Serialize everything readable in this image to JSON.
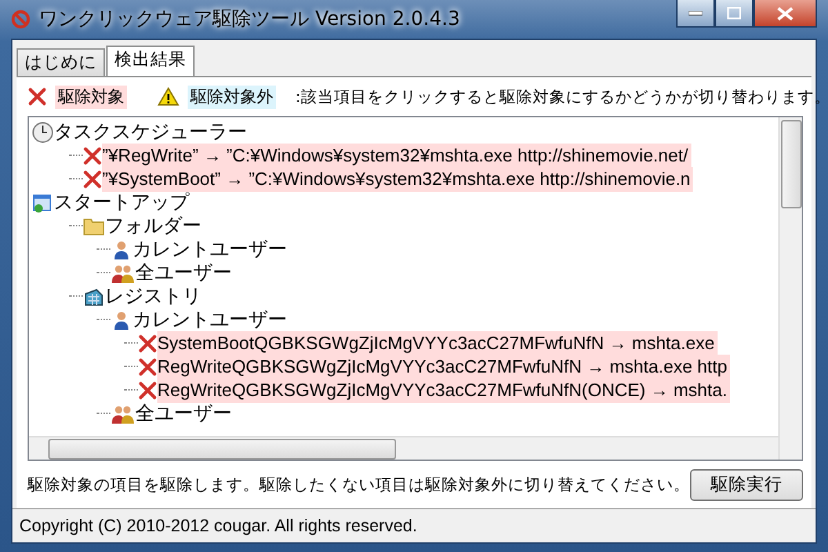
{
  "window": {
    "title": "ワンクリックウェア駆除ツール  Version 2.0.4.3"
  },
  "tabs": [
    {
      "label": "はじめに",
      "selected": false
    },
    {
      "label": "検出結果",
      "selected": true
    }
  ],
  "legend": {
    "target_label": "駆除対象",
    "excluded_label": "駆除対象外",
    "hint": ":該当項目をクリックすると駆除対象にするかどうかが切り替わります。"
  },
  "tree": [
    {
      "kind": "clock",
      "label": "タスクスケジューラー",
      "children": [
        {
          "kind": "entry",
          "target": true,
          "label": "”¥RegWrite” → ”C:¥Windows¥system32¥mshta.exe http://shinemovie.net/"
        },
        {
          "kind": "entry",
          "target": true,
          "label": "”¥SystemBoot” → ”C:¥Windows¥system32¥mshta.exe http://shinemovie.n"
        }
      ]
    },
    {
      "kind": "startup",
      "label": "スタートアップ",
      "children": [
        {
          "kind": "folder",
          "label": "フォルダー",
          "children": [
            {
              "kind": "user",
              "label": "カレントユーザー"
            },
            {
              "kind": "users",
              "label": "全ユーザー"
            }
          ]
        },
        {
          "kind": "registry",
          "label": "レジストリ",
          "children": [
            {
              "kind": "user",
              "label": "カレントユーザー",
              "children": [
                {
                  "kind": "entry",
                  "target": true,
                  "label": "SystemBootQGBKSGWgZjIcMgVYYc3acC27MFwfuNfN → mshta.exe"
                },
                {
                  "kind": "entry",
                  "target": true,
                  "label": "RegWriteQGBKSGWgZjIcMgVYYc3acC27MFwfuNfN → mshta.exe http"
                },
                {
                  "kind": "entry",
                  "target": true,
                  "label": "RegWriteQGBKSGWgZjIcMgVYYc3acC27MFwfuNfN(ONCE) → mshta."
                }
              ]
            },
            {
              "kind": "users",
              "label": "全ユーザー"
            }
          ]
        }
      ]
    }
  ],
  "footer": {
    "message": "駆除対象の項目を駆除します。駆除したくない項目は駆除対象外に切り替えてください。",
    "button": "駆除実行"
  },
  "status_bar": {
    "text": "Copyright (C) 2010-2012 cougar. All rights reserved."
  }
}
